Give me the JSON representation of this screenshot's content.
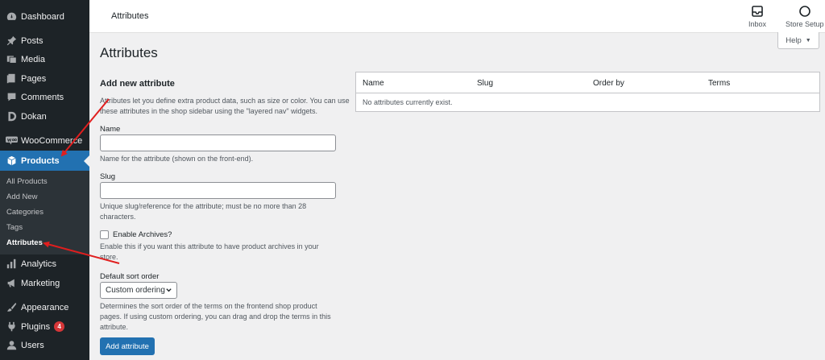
{
  "sidebar": {
    "items": [
      {
        "label": "Dashboard",
        "icon": "dashboard-icon"
      },
      {
        "label": "Posts",
        "icon": "pin-icon"
      },
      {
        "label": "Media",
        "icon": "media-icon"
      },
      {
        "label": "Pages",
        "icon": "pages-icon"
      },
      {
        "label": "Comments",
        "icon": "comment-icon"
      },
      {
        "label": "Dokan",
        "icon": "dokan-icon"
      },
      {
        "label": "WooCommerce",
        "icon": "woo-icon"
      },
      {
        "label": "Products",
        "icon": "box-icon"
      },
      {
        "label": "Analytics",
        "icon": "chart-icon"
      },
      {
        "label": "Marketing",
        "icon": "megaphone-icon"
      },
      {
        "label": "Appearance",
        "icon": "brush-icon"
      },
      {
        "label": "Plugins",
        "icon": "plug-icon",
        "badge": "4"
      },
      {
        "label": "Users",
        "icon": "user-icon"
      }
    ],
    "submenu": [
      "All Products",
      "Add New",
      "Categories",
      "Tags",
      "Attributes"
    ]
  },
  "header": {
    "title": "Attributes",
    "inbox": "Inbox",
    "store_setup": "Store Setup",
    "help": "Help"
  },
  "main": {
    "title": "Attributes",
    "form_title": "Add new attribute",
    "intro_line1": "Attributes let you define extra product data, such as size or color. You can use",
    "intro_line2": "these attributes in the shop sidebar using the \"layered nav\" widgets.",
    "name_label": "Name",
    "name_help": "Name for the attribute (shown on the front-end).",
    "slug_label": "Slug",
    "slug_help_line1": "Unique slug/reference for the attribute; must be no more than 28",
    "slug_help_line2": "characters.",
    "archives_label": "Enable Archives?",
    "archives_help_line1": "Enable this if you want this attribute to have product archives in your",
    "archives_help_line2": "store.",
    "sort_label": "Default sort order",
    "sort_value": "Custom ordering",
    "sort_help_line1": "Determines the sort order of the terms on the frontend shop product",
    "sort_help_line2": "pages. If using custom ordering, you can drag and drop the terms in this",
    "sort_help_line3": "attribute.",
    "submit": "Add attribute"
  },
  "table": {
    "columns": [
      "Name",
      "Slug",
      "Order by",
      "Terms"
    ],
    "empty": "No attributes currently exist."
  },
  "colors": {
    "sidebar_bg": "#1d2327",
    "accent": "#2271b1",
    "annotation_arrow": "#e01e1e",
    "badge": "#d63638"
  }
}
